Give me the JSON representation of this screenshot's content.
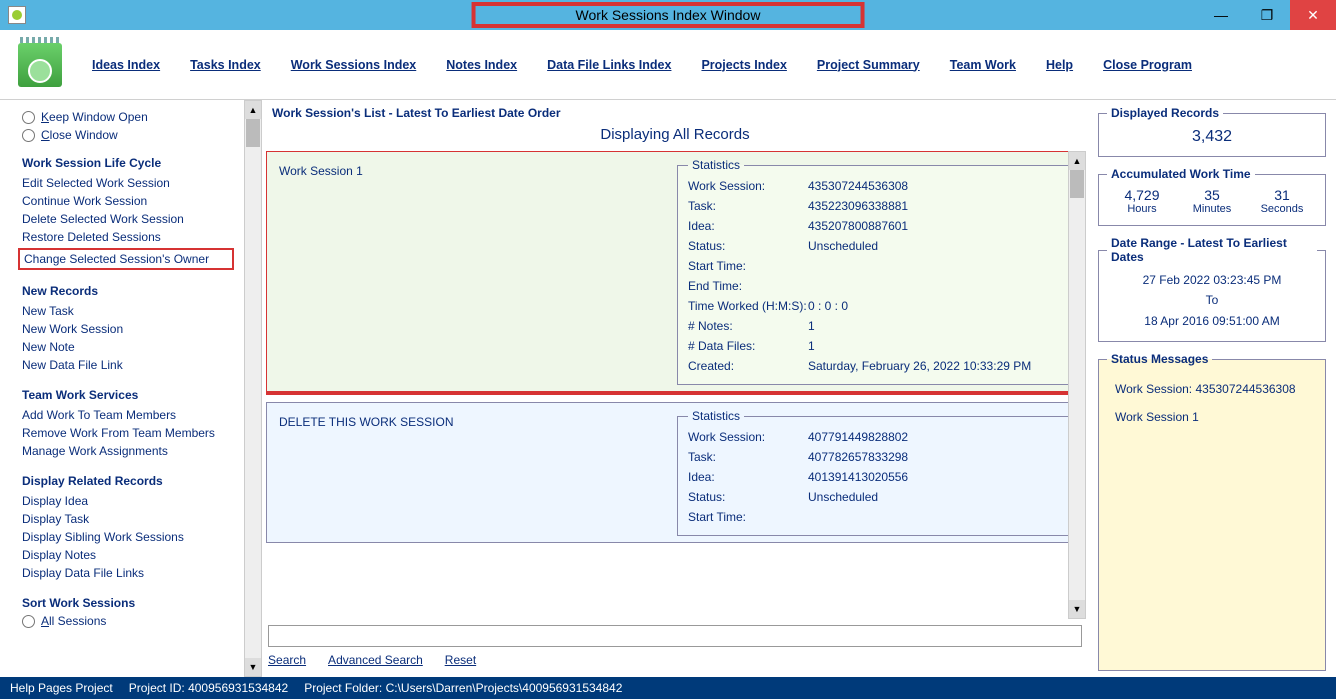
{
  "window": {
    "title": "Work Sessions Index Window"
  },
  "menu": {
    "ideas": "Ideas Index",
    "tasks": "Tasks Index",
    "work_sessions": "Work Sessions Index",
    "notes": "Notes Index",
    "datafiles": "Data File Links Index",
    "projects": "Projects Index",
    "summary": "Project Summary",
    "teamwork": "Team Work",
    "help": "Help",
    "close": "Close Program"
  },
  "sidebar": {
    "keep_open": "Keep Window Open",
    "close_window": "Close Window",
    "heading_lifecycle": "Work Session Life Cycle",
    "edit_selected": "Edit Selected Work Session",
    "continue_ws": "Continue Work Session",
    "delete_selected": "Delete Selected Work Session",
    "restore_deleted": "Restore Deleted Sessions",
    "change_owner": "Change Selected Session's Owner",
    "heading_new": "New Records",
    "new_task": "New Task",
    "new_ws": "New Work Session",
    "new_note": "New Note",
    "new_dfl": "New Data File Link",
    "heading_team": "Team Work Services",
    "add_team": "Add Work To Team Members",
    "remove_team": "Remove Work From Team Members",
    "manage_assign": "Manage Work Assignments",
    "heading_related": "Display Related Records",
    "disp_idea": "Display Idea",
    "disp_task": "Display Task",
    "disp_siblings": "Display Sibling Work Sessions",
    "disp_notes": "Display Notes",
    "disp_dfl": "Display Data File Links",
    "heading_sort": "Sort Work Sessions",
    "all_sessions": "All Sessions"
  },
  "list": {
    "title": "Work Session's List - Latest To Earliest Date Order",
    "header": "Displaying All Records",
    "stats_legend": "Statistics",
    "labels": {
      "ws": "Work Session:",
      "task": "Task:",
      "idea": "Idea:",
      "status": "Status:",
      "start": "Start Time:",
      "end": "End Time:",
      "timeworked": "Time Worked (H:M:S):",
      "notes": "# Notes:",
      "datafiles": "# Data Files:",
      "created": "Created:"
    },
    "row0": {
      "title": "Work Session 1",
      "ws": "435307244536308",
      "task": "435223096338881",
      "idea": "435207800887601",
      "status": "Unscheduled",
      "start": "",
      "end": "",
      "timeworked": "0   :   0   :   0",
      "notes": "1",
      "datafiles": "1",
      "created": "Saturday, February 26, 2022   10:33:29 PM"
    },
    "row1": {
      "title": "DELETE THIS WORK SESSION",
      "ws": "407791449828802",
      "task": "407782657833298",
      "idea": "401391413020556",
      "status": "Unscheduled",
      "start": ""
    }
  },
  "search": {
    "search": "Search",
    "advanced": "Advanced Search",
    "reset": "Reset",
    "placeholder": ""
  },
  "right": {
    "displayed_legend": "Displayed Records",
    "displayed_count": "3,432",
    "accum_legend": "Accumulated Work Time",
    "accum_hours": "4,729",
    "accum_hours_cap": "Hours",
    "accum_min": "35",
    "accum_min_cap": "Minutes",
    "accum_sec": "31",
    "accum_sec_cap": "Seconds",
    "range_legend": "Date Range - Latest To Earliest Dates",
    "range_from": "27 Feb 2022  03:23:45 PM",
    "range_to": "To",
    "range_to_date": "18 Apr 2016  09:51:00 AM",
    "status_legend": "Status Messages",
    "status_line1": "Work Session: 435307244536308",
    "status_line2": "Work Session 1"
  },
  "footer": {
    "help": "Help Pages Project",
    "pid": "Project ID:  400956931534842",
    "pfolder": "Project Folder:  C:\\Users\\Darren\\Projects\\400956931534842"
  }
}
